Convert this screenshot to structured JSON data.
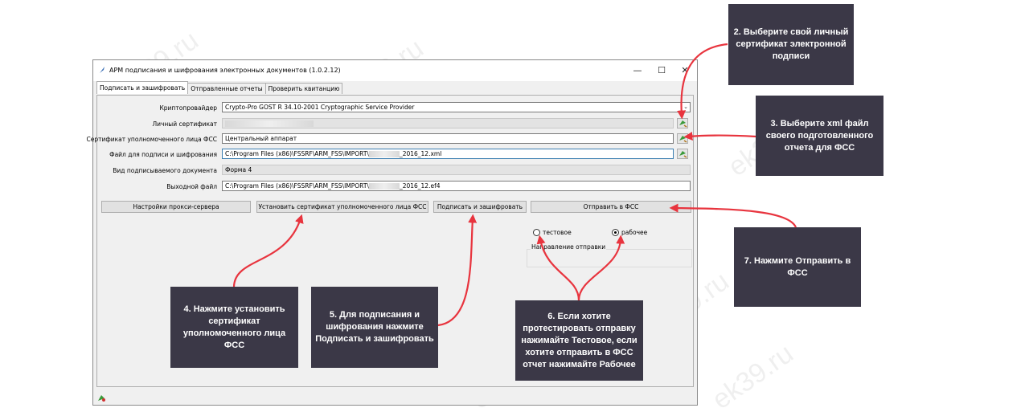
{
  "window": {
    "title": "АРМ подписания и шифрования электронных документов (1.0.2.12)",
    "minimize": "—",
    "maximize": "☐",
    "close": "✕"
  },
  "tabs": [
    "Подписать и зашифровать",
    "Отправленные отчеты",
    "Проверить квитанцию"
  ],
  "form": {
    "crypto_label": "Криптопровайдер",
    "crypto_value": "Crypto-Pro GOST R 34.10-2001 Cryptographic Service Provider",
    "cert_label": "Личный сертификат",
    "fss_cert_label": "Сертификат уполномоченного лица ФСС",
    "fss_cert_value": "Центральный аппарат",
    "file_label": "Файл для подписи и шифрования",
    "file_value_prefix": "C:\\Program Files (x86)\\FSSRF\\ARM_FSS\\IMPORT\\",
    "file_value_suffix": "_2016_12.xml",
    "doc_type_label": "Вид подписываемого документа",
    "doc_type_value": "Форма 4",
    "output_label": "Выходной файл",
    "output_value_prefix": "C:\\Program Files (x86)\\FSSRF\\ARM_FSS\\IMPORT\\",
    "output_value_suffix": "_2016_12.ef4"
  },
  "buttons": {
    "proxy": "Настройки прокси-сервера",
    "install_cert": "Установить сертификат уполномоченного лица ФСС",
    "sign_encrypt": "Подписать и зашифровать",
    "send": "Отправить в ФСС"
  },
  "direction": {
    "title": "Направление отправки",
    "test": "тестовое",
    "work": "рабочее",
    "selected": "рабочее"
  },
  "callouts": {
    "c2": "2. Выберите свой личный сертификат электронной подписи",
    "c3": "3. Выберите xml файл своего подготовленного отчета для ФСС",
    "c4": "4. Нажмите установить сертификат уполномоченного лица ФСС",
    "c5": "5. Для подписания и шифрования нажмите Подписать и зашифровать",
    "c6": "6. Если хотите протестировать отправку нажимайте Тестовое, если хотите отправить в ФСС отчет нажимайте Рабочее",
    "c7": "7. Нажмите Отправить в ФСС"
  },
  "watermark": "ek39.ru",
  "colors": {
    "arrow": "#e8343e",
    "callout_bg": "#3b3847"
  }
}
